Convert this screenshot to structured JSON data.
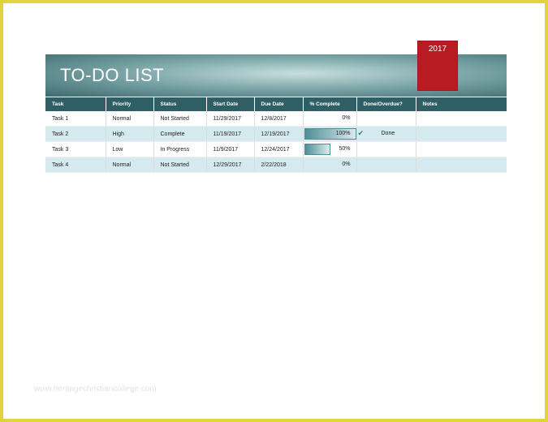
{
  "document": {
    "title": "TO-DO LIST",
    "year": "2017",
    "watermark": "www.heritagechristiancollege.com"
  },
  "colors": {
    "header": "#2f5e64",
    "year_box": "#b81c22",
    "alt_row": "#d4eaee",
    "frame": "#e2d23c"
  },
  "table": {
    "headers": [
      "Task",
      "Priority",
      "Status",
      "Start Date",
      "Due Date",
      "% Complete",
      "Done/Overdue?",
      "Notes"
    ],
    "rows": [
      {
        "task": "Task 1",
        "priority": "Normal",
        "status": "Not Started",
        "start": "11/29/2017",
        "due": "12/8/2017",
        "pct": "0%",
        "pct_value": 0,
        "done": "",
        "done_icon": "",
        "notes": ""
      },
      {
        "task": "Task 2",
        "priority": "High",
        "status": "Complete",
        "start": "11/19/2017",
        "due": "12/19/2017",
        "pct": "100%",
        "pct_value": 100,
        "done": "Done",
        "done_icon": "check-icon",
        "notes": ""
      },
      {
        "task": "Task 3",
        "priority": "Low",
        "status": "In Progress",
        "start": "11/9/2017",
        "due": "12/24/2017",
        "pct": "50%",
        "pct_value": 50,
        "done": "",
        "done_icon": "",
        "notes": ""
      },
      {
        "task": "Task 4",
        "priority": "Normal",
        "status": "Not Started",
        "start": "12/29/2017",
        "due": "2/22/2018",
        "pct": "0%",
        "pct_value": 0,
        "done": "",
        "done_icon": "",
        "notes": ""
      }
    ]
  }
}
